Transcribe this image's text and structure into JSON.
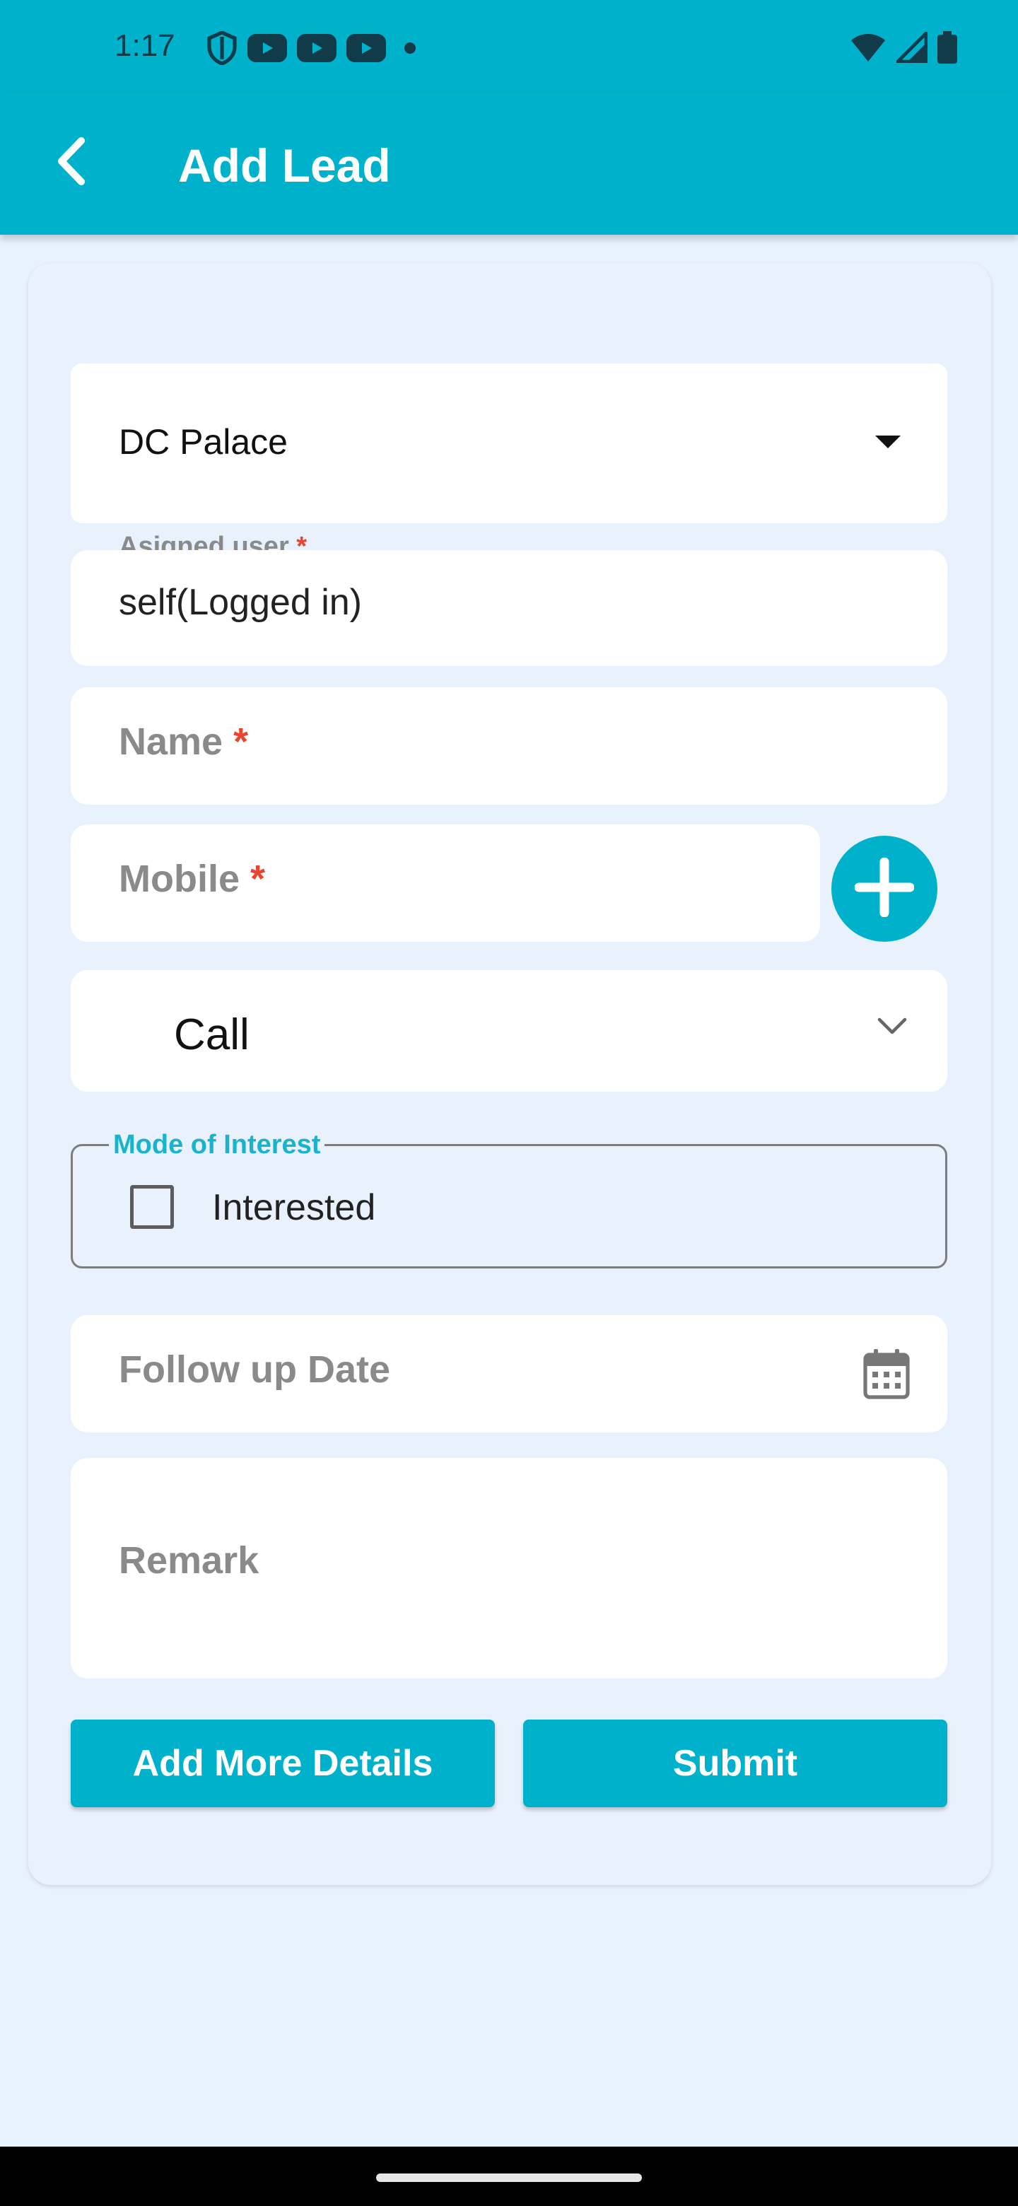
{
  "status_bar": {
    "time": "1:17",
    "left_icons": [
      "shield-icon",
      "youtube-icon",
      "youtube-icon",
      "youtube-icon",
      "dot-icon"
    ],
    "right_icons": [
      "wifi-icon",
      "signal-icon",
      "battery-icon"
    ]
  },
  "app_bar": {
    "title": "Add Lead",
    "back_icon": "back-arrow-icon"
  },
  "form": {
    "project": {
      "value": "DC Palace",
      "icon": "caret-down-icon"
    },
    "assigned_user": {
      "label": "Asigned user",
      "required_mark": "*",
      "value": "self(Logged in)"
    },
    "name": {
      "placeholder": "Name",
      "required_mark": "*"
    },
    "mobile": {
      "placeholder": "Mobile",
      "required_mark": "*",
      "add_icon": "plus-icon"
    },
    "lead_type": {
      "value": "Call",
      "icon": "chevron-down-icon"
    },
    "mode_of_interest": {
      "label": "Mode of Interest",
      "option": "Interested",
      "checked": false
    },
    "follow_up_date": {
      "placeholder": "Follow up Date",
      "icon": "calendar-icon"
    },
    "remark": {
      "placeholder": "Remark"
    }
  },
  "buttons": {
    "add_more": "Add More Details",
    "submit": "Submit"
  },
  "colors": {
    "primary": "#00b1cb",
    "background": "#e8f2fc",
    "required": "#e9442e",
    "placeholder": "#8a8a8a"
  }
}
